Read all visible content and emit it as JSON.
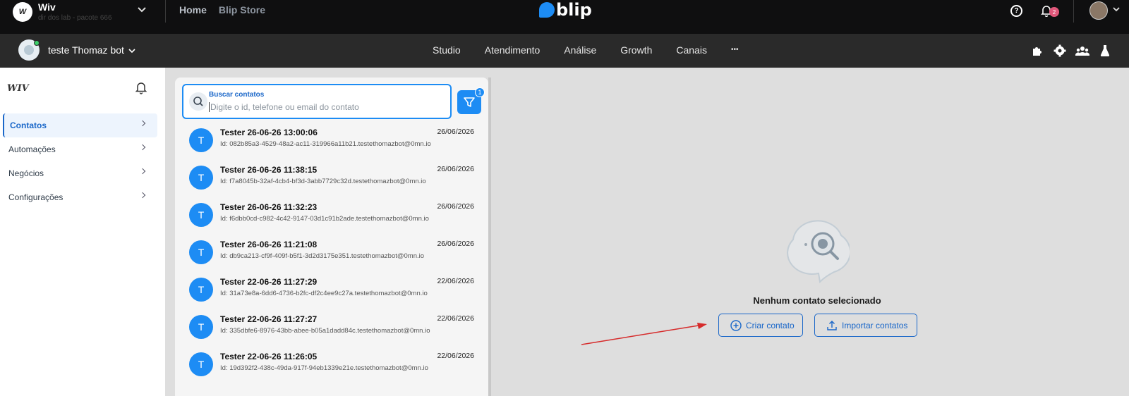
{
  "topbar": {
    "org_name": "Wiv",
    "org_sub": "dir dos lab - pacote 666",
    "org_logo": "W",
    "nav_home": "Home",
    "nav_store": "Blip Store",
    "brand": "blip",
    "help": "?",
    "notifications_count": "2"
  },
  "botbar": {
    "bot_name": "teste Thomaz bot",
    "nav": [
      "Studio",
      "Atendimento",
      "Análise",
      "Growth",
      "Canais"
    ],
    "more": "•••"
  },
  "sidebar": {
    "logo": "WIV",
    "items": [
      {
        "label": "Contatos",
        "active": true
      },
      {
        "label": "Automações",
        "active": false
      },
      {
        "label": "Negócios",
        "active": false
      },
      {
        "label": "Configurações",
        "active": false
      }
    ]
  },
  "search": {
    "label": "Buscar contatos",
    "placeholder": "Digite o id, telefone ou email do contato",
    "value": "",
    "filter_count": "1"
  },
  "contacts": [
    {
      "initial": "T",
      "name": "Tester 26-06-26 13:00:06",
      "id": "Id: 082b85a3-4529-48a2-ac11-319966a11b21.testethomazbot@0mn.io",
      "date": "26/06/2026"
    },
    {
      "initial": "T",
      "name": "Tester 26-06-26 11:38:15",
      "id": "Id: f7a8045b-32af-4cb4-bf3d-3abb7729c32d.testethomazbot@0mn.io",
      "date": "26/06/2026"
    },
    {
      "initial": "T",
      "name": "Tester 26-06-26 11:32:23",
      "id": "Id: f6dbb0cd-c982-4c42-9147-03d1c91b2ade.testethomazbot@0mn.io",
      "date": "26/06/2026"
    },
    {
      "initial": "T",
      "name": "Tester 26-06-26 11:21:08",
      "id": "Id: db9ca213-cf9f-409f-b5f1-3d2d3175e351.testethomazbot@0mn.io",
      "date": "26/06/2026"
    },
    {
      "initial": "T",
      "name": "Tester 22-06-26 11:27:29",
      "id": "Id: 31a73e8a-6dd6-4736-b2fc-df2c4ee9c27a.testethomazbot@0mn.io",
      "date": "22/06/2026"
    },
    {
      "initial": "T",
      "name": "Tester 22-06-26 11:27:27",
      "id": "Id: 335dbfe6-8976-43bb-abee-b05a1dadd84c.testethomazbot@0mn.io",
      "date": "22/06/2026"
    },
    {
      "initial": "T",
      "name": "Tester 22-06-26 11:26:05",
      "id": "Id: 19d392f2-438c-49da-917f-94eb1339e21e.testethomazbot@0mn.io",
      "date": "22/06/2026"
    }
  ],
  "empty_state": {
    "title": "Nenhum contato selecionado",
    "create_label": "Criar contato",
    "import_label": "Importar contatos"
  },
  "colors": {
    "accent": "#1d8cf4",
    "link": "#1a67c9",
    "annotation_arrow": "#d62b2b"
  }
}
